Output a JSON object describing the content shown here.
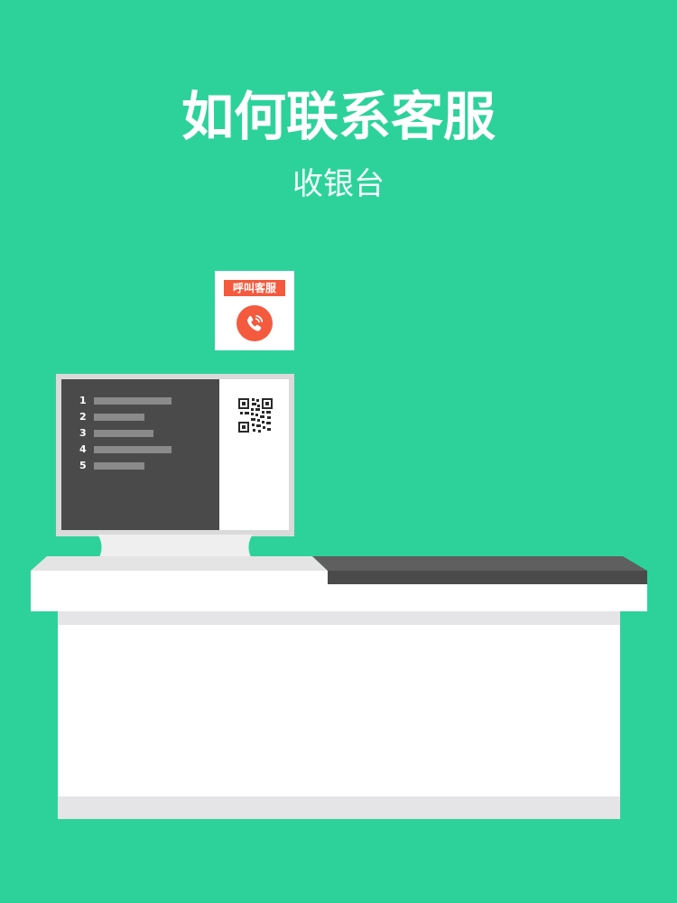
{
  "page": {
    "title": "如何联系客服",
    "subtitle": "收银台"
  },
  "call_sign": {
    "label": "呼叫客服",
    "icon": "phone-icon"
  },
  "screen": {
    "rows": [
      {
        "number": "1"
      },
      {
        "number": "2"
      },
      {
        "number": "3"
      },
      {
        "number": "4"
      },
      {
        "number": "5"
      }
    ],
    "qr_icon": "qr-code-icon"
  },
  "colors": {
    "background": "#2dd29b",
    "accent": "#f45a3d",
    "screen_panel": "#4a4a4a",
    "counter_top_dark": "#4a4a4a"
  }
}
